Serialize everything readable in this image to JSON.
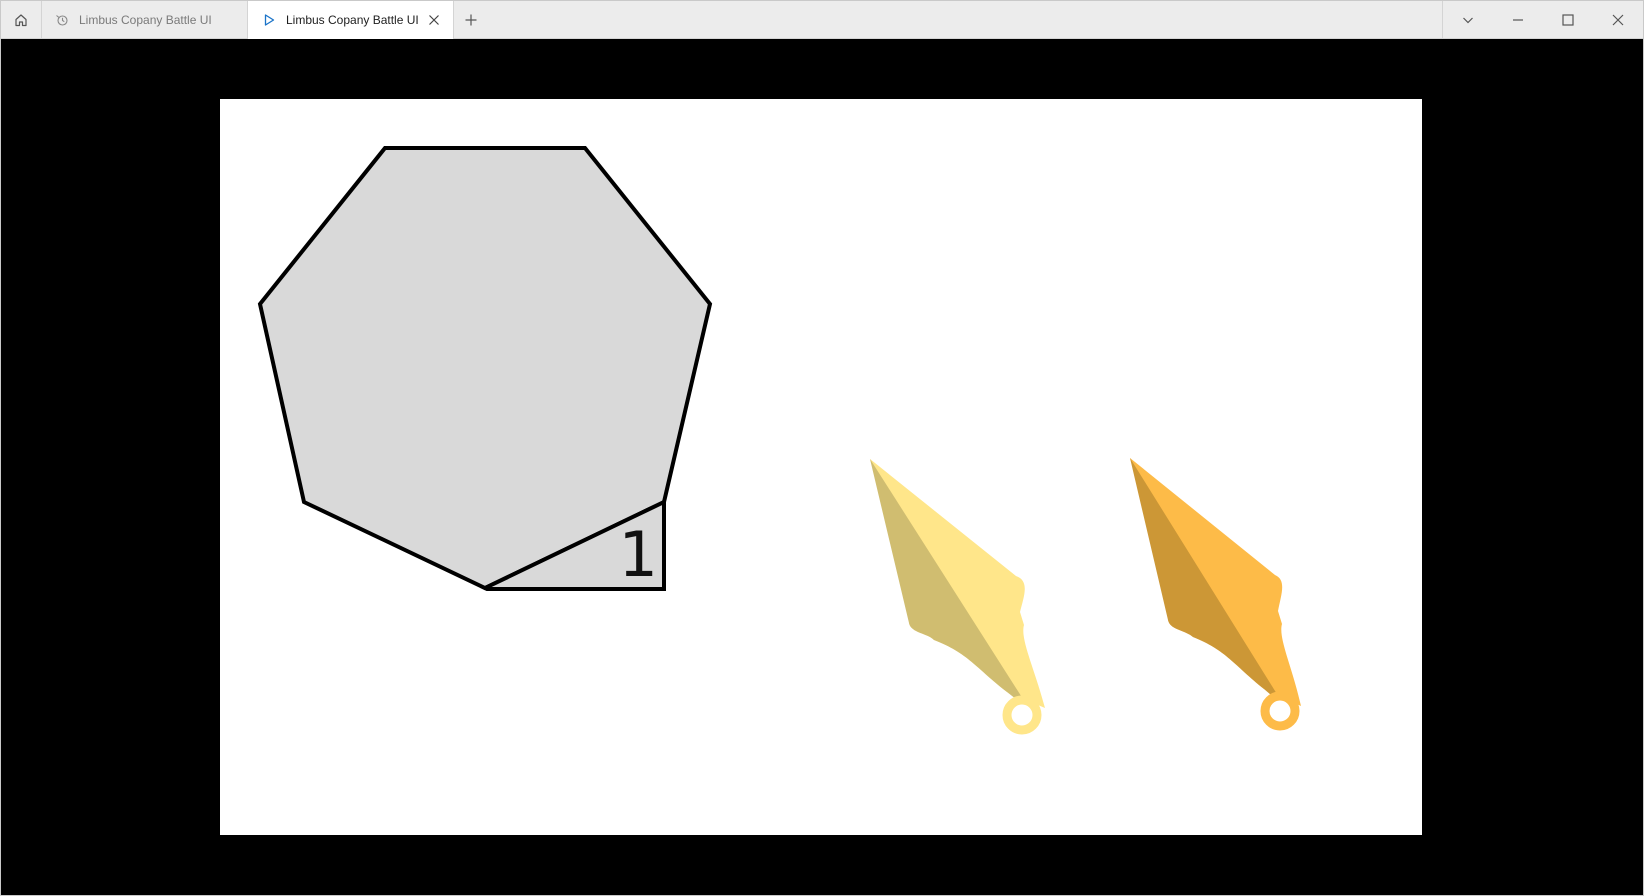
{
  "window": {
    "tabs": [
      {
        "label": "Limbus Copany Battle UI",
        "icon": "leaf-stopwatch-icon",
        "active": false
      },
      {
        "label": "Limbus Copany Battle UI",
        "icon": "play-icon",
        "active": true
      }
    ],
    "controls": [
      "chevron-down-icon",
      "minimize-icon",
      "maximize-icon",
      "close-icon"
    ]
  },
  "stage": {
    "background": "#000000",
    "canvas_background": "#ffffff",
    "heptagon": {
      "fill": "#d9d9d9",
      "stroke": "#000000"
    },
    "counter": {
      "value": "1"
    },
    "pointers": [
      {
        "name": "pale-yellow-pointer",
        "light": "#ffe68a",
        "dark": "#d0bd70",
        "ring": "#ffe68a"
      },
      {
        "name": "orange-pointer",
        "light": "#fdbb48",
        "dark": "#cc9736",
        "ring": "#fdbb48"
      }
    ]
  }
}
